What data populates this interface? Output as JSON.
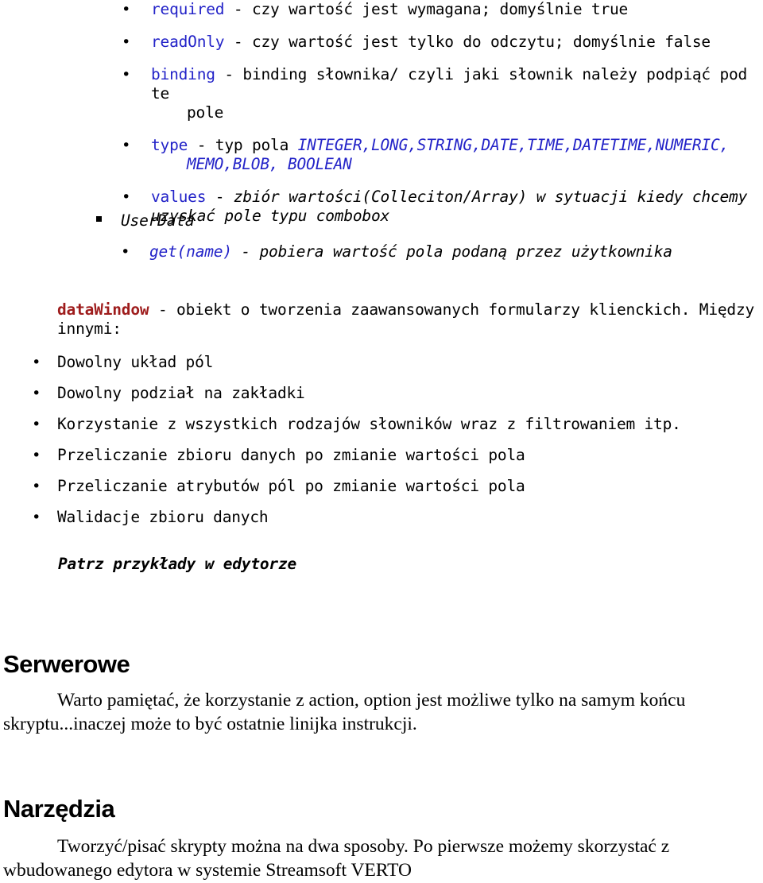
{
  "document": {
    "attributes_list": [
      {
        "bullet": "•",
        "name": "required",
        "name_style": "blue",
        "desc": " - czy wartość jest wymagana; domyślnie true",
        "continuation": ""
      },
      {
        "bullet": "•",
        "name": "readOnly",
        "name_style": "blue",
        "desc": " - czy wartość jest tylko do odczytu; domyślnie false",
        "continuation": ""
      },
      {
        "bullet": "•",
        "name": "binding",
        "name_style": "blue",
        "desc": " - binding słownika/ czyli jaki słownik należy podpiąć pod te",
        "continuation": "pole"
      },
      {
        "bullet": "•",
        "name": "type",
        "name_style": "blue",
        "desc": " - typ pola ",
        "desc_blue_italic": "INTEGER,LONG,STRING,DATE,TIME,DATETIME,NUMERIC,",
        "continuation_blue_italic": "MEMO,BLOB, BOOLEAN"
      },
      {
        "bullet": "•",
        "name": "values",
        "name_style": "blue",
        "desc": " - ",
        "desc_italic": "zbiór wartości(Colleciton/Array) w sytuacji kiedy chcemy",
        "continuation_italic": "uzyskać pole typu combobox"
      }
    ],
    "userdata": {
      "bullet": "■",
      "label": "UserData",
      "child": {
        "bullet": "•",
        "name": "get(name)",
        "desc": " - pobiera wartość pola podaną przez użytkownika"
      }
    },
    "datawindow": {
      "name": "dataWindow",
      "name_color": "#9e1c1c",
      "desc": " - obiekt o tworzenia zaawansowanych formularzy klienckich. Między innymi:",
      "features": [
        {
          "bullet": "•",
          "text": "Dowolny układ pól"
        },
        {
          "bullet": "•",
          "text": "Dowolny podział na zakładki"
        },
        {
          "bullet": "•",
          "text": "Korzystanie z wszystkich rodzajów słowników wraz z filtrowaniem itp."
        },
        {
          "bullet": "•",
          "text": "Przeliczanie zbioru danych po zmianie wartości pola"
        },
        {
          "bullet": "•",
          "text": "Przeliczanie atrybutów pól po zmianie wartości pola"
        },
        {
          "bullet": "•",
          "text": "Walidacje zbioru danych"
        }
      ],
      "note": "Patrz  przykłady w edytorze"
    },
    "sections": [
      {
        "heading": "Serwerowe",
        "paragraph": "Warto pamiętać, że korzystanie z action, option jest możliwe tylko na samym końcu skryptu...inaczej może to być ostatnie linijka instrukcji."
      },
      {
        "heading": "Narzędzia",
        "paragraph": "Tworzyć/pisać skrypty można na dwa sposoby. Po pierwsze możemy skorzystać z wbudowanego edytora w systemie Streamsoft VERTO"
      }
    ],
    "colors": {
      "keyword_blue": "#2323c8",
      "datawindow_red": "#9e1c1c",
      "text_black": "#000000",
      "background": "#ffffff"
    }
  }
}
